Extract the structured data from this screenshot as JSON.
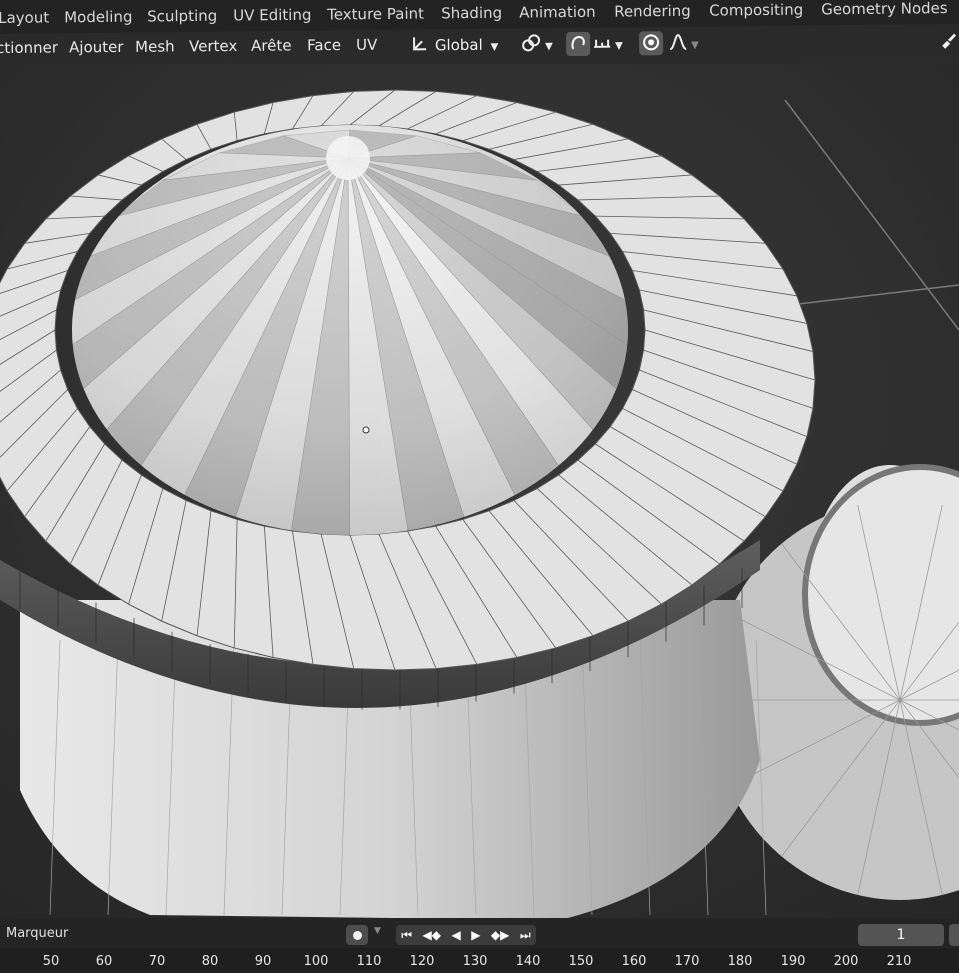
{
  "workspace_tabs": [
    {
      "label": "Layout",
      "active": true
    },
    {
      "label": "Modeling",
      "active": false
    },
    {
      "label": "Sculpting",
      "active": false
    },
    {
      "label": "UV Editing",
      "active": false
    },
    {
      "label": "Texture Paint",
      "active": false
    },
    {
      "label": "Shading",
      "active": false
    },
    {
      "label": "Animation",
      "active": false
    },
    {
      "label": "Rendering",
      "active": false
    },
    {
      "label": "Compositing",
      "active": false
    },
    {
      "label": "Geometry Nodes",
      "active": false
    }
  ],
  "header_menu": [
    "ctionner",
    "Ajouter",
    "Mesh",
    "Vertex",
    "Arête",
    "Face",
    "UV"
  ],
  "header_tools": {
    "transform_orientation": "Global",
    "icons": [
      "transform-pivot-icon",
      "snap-link-icon",
      "snap-magnet-icon",
      "snap-increment-icon",
      "proportional-edit-icon",
      "falloff-curve-icon"
    ]
  },
  "timeline": {
    "marker_label": "Marqueur",
    "current_frame": "1",
    "ticks": [
      "50",
      "60",
      "70",
      "80",
      "90",
      "100",
      "110",
      "120",
      "130",
      "140",
      "150",
      "160",
      "170",
      "180",
      "190",
      "200",
      "210"
    ],
    "playback_icons": [
      "jump-start-icon",
      "prev-keyframe-icon",
      "play-reverse-icon",
      "play-icon",
      "next-keyframe-icon",
      "jump-end-icon"
    ]
  },
  "colors": {
    "topbar_bg": "#232323",
    "active_tab_bg": "#444444",
    "viewport_bg": "#2e2e2e",
    "mesh_face": "#d9d9d9",
    "timeline_bg": "#1f1f1f"
  }
}
